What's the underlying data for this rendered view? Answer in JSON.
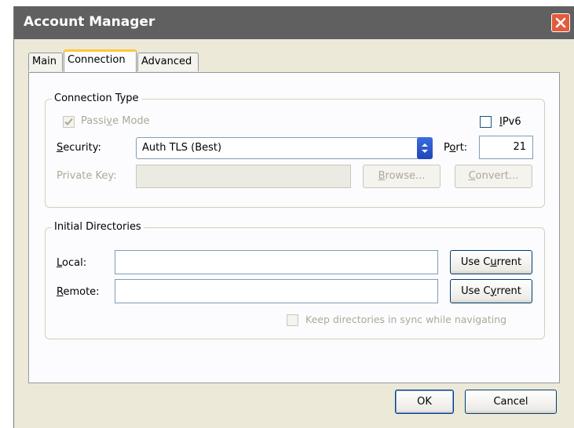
{
  "window": {
    "title": "Account Manager"
  },
  "tabs": [
    {
      "label": "Main",
      "active": false
    },
    {
      "label": "Connection",
      "active": true
    },
    {
      "label": "Advanced",
      "active": false
    }
  ],
  "connection_type": {
    "group_label": "Connection Type",
    "passive_mode": {
      "label_pre": "Passi",
      "label_key": "v",
      "label_post": "e Mode",
      "checked": true,
      "enabled": false
    },
    "ipv6": {
      "label_key": "I",
      "label_post": "Pv6",
      "checked": false
    },
    "security": {
      "label_key": "S",
      "label_post": "ecurity:",
      "value": "Auth TLS (Best)"
    },
    "port": {
      "label_pre": "P",
      "label_key": "o",
      "label_post": "rt:",
      "value": "21"
    },
    "private_key": {
      "label": "Private Key:",
      "value": ""
    },
    "browse_button": {
      "label_key": "B",
      "label_post": "rowse..."
    },
    "convert_button": {
      "label_key": "C",
      "label_post": "onvert..."
    }
  },
  "initial_directories": {
    "group_label": "Initial Directories",
    "local": {
      "label_key": "L",
      "label_post": "ocal:",
      "value": ""
    },
    "remote": {
      "label_key": "R",
      "label_post": "emote:",
      "value": ""
    },
    "use_current_local": {
      "label_pre": "Use C",
      "label_key": "u",
      "label_post": "rrent"
    },
    "use_current_remote": {
      "label_pre": "Use C",
      "label_key": "y",
      "label_post": "rrent"
    },
    "keep_sync": {
      "label": "Keep directories in sync while navigating",
      "checked": false,
      "enabled": false
    }
  },
  "footer": {
    "ok_label": "OK",
    "cancel_label": "Cancel"
  }
}
